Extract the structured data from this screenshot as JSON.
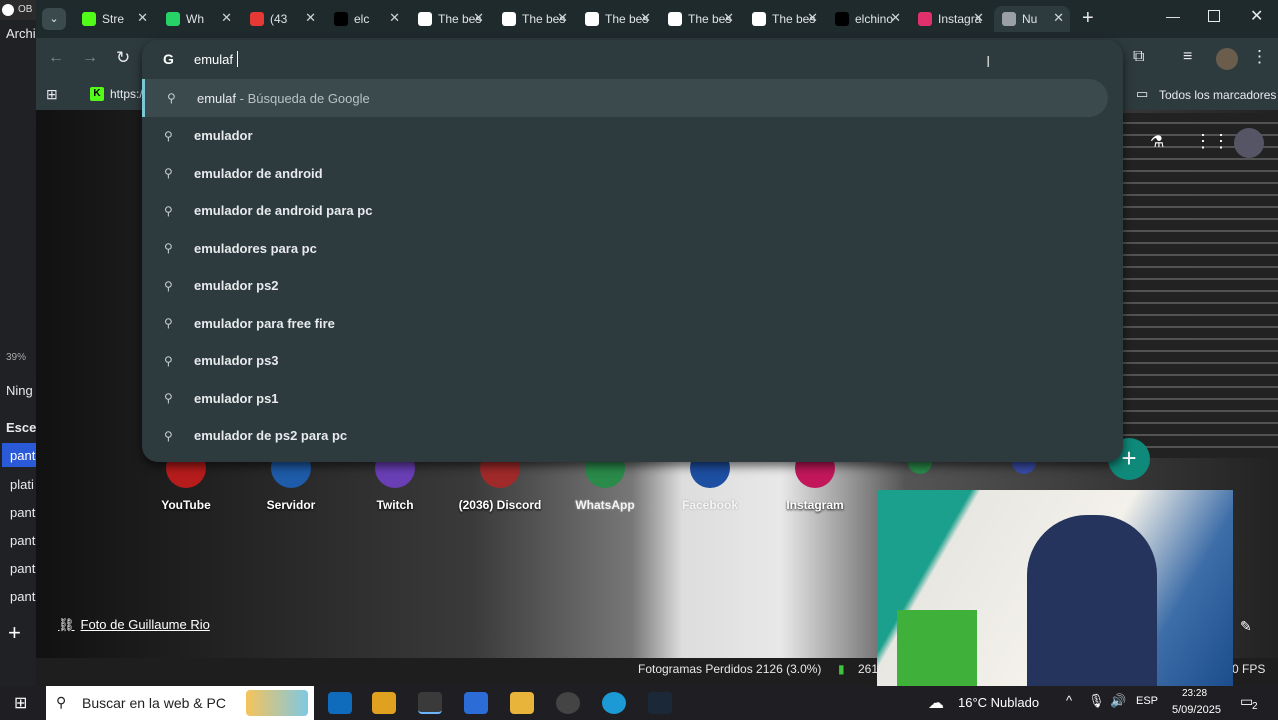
{
  "obs": {
    "zoom": "39%",
    "left_labels": [
      "Archi",
      "Ning",
      "Esce",
      "pant",
      "plati",
      "pant",
      "pant",
      "pant",
      "pant"
    ],
    "frames_lost": "Fotogramas Perdidos 2126 (3.0%)",
    "bitrate_partial": "261",
    "fps_partial": "0 FPS",
    "top_fragment": "OB"
  },
  "tabs": [
    {
      "label": "Stre",
      "icon": "kick-icon",
      "color": "#53fc18"
    },
    {
      "label": "Wh",
      "icon": "whatsapp-icon",
      "color": "#25d366"
    },
    {
      "label": "(43",
      "icon": "chrome-tab-icon",
      "color": "#e53935"
    },
    {
      "label": "elc",
      "icon": "tiktok-icon",
      "color": "#000000"
    },
    {
      "label": "The bes",
      "icon": "diamond-icon",
      "color": "#ffffff"
    },
    {
      "label": "The bes",
      "icon": "diamond-icon",
      "color": "#ffffff"
    },
    {
      "label": "The bes",
      "icon": "diamond-icon",
      "color": "#ffffff"
    },
    {
      "label": "The bes",
      "icon": "diamond-icon",
      "color": "#ffffff"
    },
    {
      "label": "The bes",
      "icon": "diamond-icon",
      "color": "#ffffff"
    },
    {
      "label": "elchino",
      "icon": "tiktok-icon",
      "color": "#000000"
    },
    {
      "label": "Instagra",
      "icon": "instagram-icon",
      "color": "#e1306c"
    },
    {
      "label": "Nu",
      "icon": "chrome-newtab-icon",
      "color": "#9aa0a6",
      "active": true
    }
  ],
  "omnibox": {
    "value": "emulaf",
    "google_letter": "G"
  },
  "bookmarks": {
    "first": "https:/",
    "all_label": "Todos los marcadores"
  },
  "suggestions": [
    {
      "main": "emulaf",
      "sub": " - Búsqueda de Google",
      "highlighted": true
    },
    {
      "main": "emulador"
    },
    {
      "main": "emulador de android"
    },
    {
      "main": "emulador de android para pc"
    },
    {
      "main": "emuladores para pc"
    },
    {
      "main": "emulador ps2"
    },
    {
      "main": "emulador para free fire"
    },
    {
      "main": "emulador ps3"
    },
    {
      "main": "emulador ps1"
    },
    {
      "main": "emulador de ps2 para pc"
    }
  ],
  "shortcuts": [
    "YouTube",
    "Servidor",
    "Twitch",
    "(2036) Discord",
    "WhatsApp",
    "Facebook",
    "Instagram"
  ],
  "photo_credit": "Foto de Guillaume Rio",
  "taskbar": {
    "search_placeholder": "Buscar en la web & PC",
    "weather": "16°C  Nublado",
    "lang": "ESP",
    "time": "23:28",
    "date": "5/09/2025",
    "notif_count": "2"
  }
}
